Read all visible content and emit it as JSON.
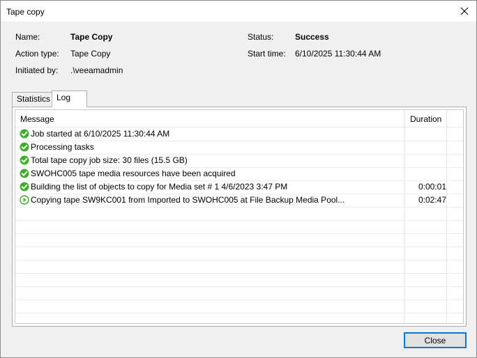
{
  "window": {
    "title": "Tape copy"
  },
  "info": {
    "name_label": "Name:",
    "name_value": "Tape Copy",
    "action_label": "Action type:",
    "action_value": "Tape Copy",
    "initiated_label": "Initiated by:",
    "initiated_value": ".\\veeamadmin",
    "status_label": "Status:",
    "status_value": "Success",
    "start_label": "Start time:",
    "start_value": "6/10/2025 11:30:44 AM"
  },
  "tabs": [
    {
      "label": "Statistics",
      "active": false
    },
    {
      "label": "Log",
      "active": true
    }
  ],
  "log": {
    "columns": {
      "message": "Message",
      "duration": "Duration"
    },
    "rows": [
      {
        "icon": "success-check-icon",
        "message": "Job started at 6/10/2025 11:30:44 AM",
        "duration": ""
      },
      {
        "icon": "success-check-icon",
        "message": "Processing tasks",
        "duration": ""
      },
      {
        "icon": "success-check-icon",
        "message": "Total tape copy job size: 30 files  (15.5 GB)",
        "duration": ""
      },
      {
        "icon": "success-check-icon",
        "message": "SWOHC005 tape media resources have been acquired",
        "duration": ""
      },
      {
        "icon": "success-check-icon",
        "message": "Building the list of objects to copy for Media set # 1 4/6/2023 3:47 PM",
        "duration": "0:00:01"
      },
      {
        "icon": "running-play-icon",
        "message": "Copying tape SW9KC001 from Imported to SWOHC005 at File Backup Media Pool...",
        "duration": "0:02:47"
      }
    ]
  },
  "buttons": {
    "close_label": "Close"
  },
  "colors": {
    "success": "#3fae2a",
    "accent": "#0078d7"
  }
}
